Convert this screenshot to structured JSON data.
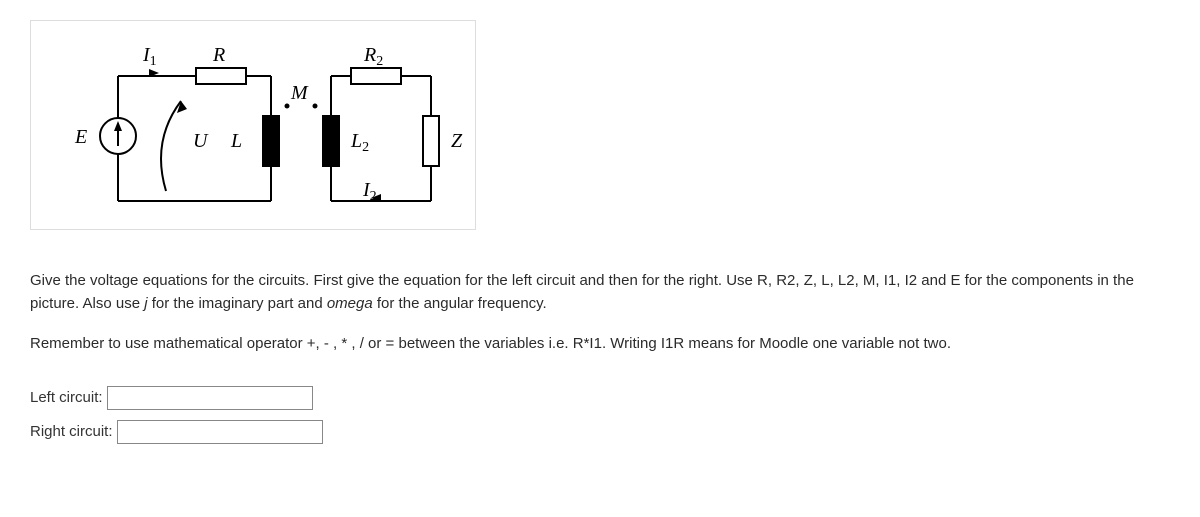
{
  "diagram": {
    "labels": {
      "E": "E",
      "I1": "I",
      "I1_sub": "1",
      "R": "R",
      "M": "M",
      "U": "U",
      "L": "L",
      "R2": "R",
      "R2_sub": "2",
      "L2": "L",
      "L2_sub": "2",
      "Z": "Z",
      "I2": "I",
      "I2_sub": "2"
    }
  },
  "instructions": {
    "para1_a": "Give the voltage equations for the circuits. First give the equation for the left circuit and then for the right. Use R, R2, Z, L, L2, M, I1, I2 and E for the components in the picture. Also use ",
    "para1_j": "j",
    "para1_b": " for the imaginary part and ",
    "para1_omega": "omega",
    "para1_c": " for the angular frequency.",
    "para2": "Remember to use mathematical operator +, - , * , / or = between the variables i.e. R*I1. Writing I1R means for Moodle one variable not two."
  },
  "answers": {
    "left_label": "Left circuit:",
    "right_label": "Right circuit:",
    "left_value": "",
    "right_value": ""
  }
}
